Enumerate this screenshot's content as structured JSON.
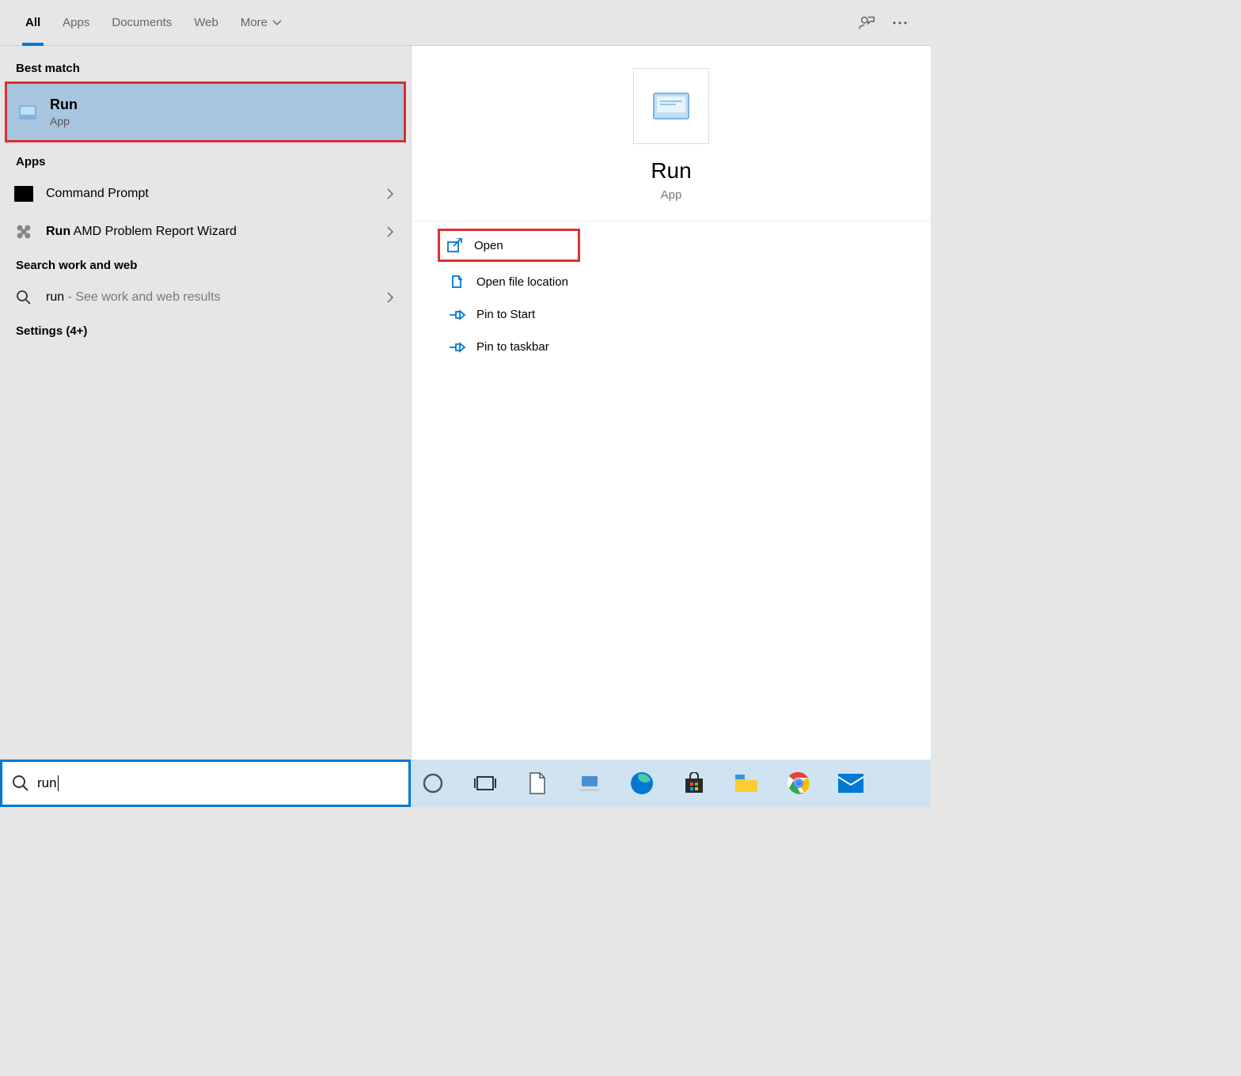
{
  "tabs": {
    "items": [
      "All",
      "Apps",
      "Documents",
      "Web",
      "More"
    ],
    "active": 0
  },
  "sections": {
    "best_match": "Best match",
    "apps": "Apps",
    "search_web": "Search work and web",
    "settings": "Settings (4+)"
  },
  "best": {
    "title": "Run",
    "subtitle": "App"
  },
  "apps": [
    {
      "title": "Command Prompt",
      "bold": ""
    },
    {
      "bold": "Run",
      "title": " AMD Problem Report Wizard"
    }
  ],
  "web": {
    "bold": "run",
    "secondary": " - See work and web results"
  },
  "preview": {
    "title": "Run",
    "subtitle": "App"
  },
  "actions": [
    {
      "label": "Open"
    },
    {
      "label": "Open file location"
    },
    {
      "label": "Pin to Start"
    },
    {
      "label": "Pin to taskbar"
    }
  ],
  "search": {
    "value": "run"
  }
}
